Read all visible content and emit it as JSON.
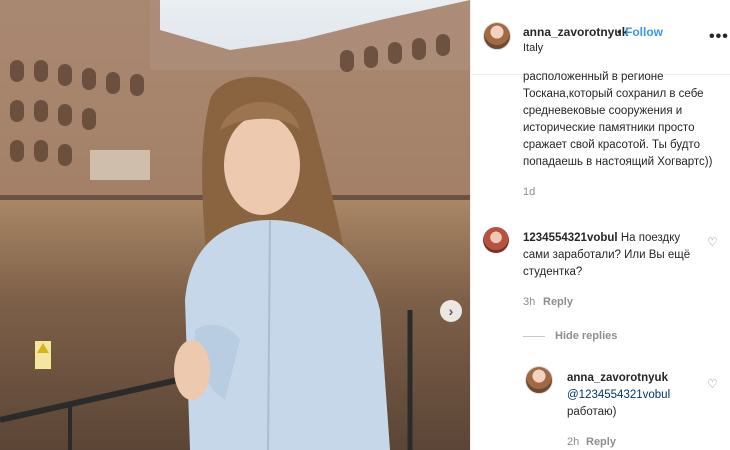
{
  "post": {
    "username": "anna_zavorotnyuk",
    "separator": "•",
    "follow_label": "Follow",
    "location": "Italy",
    "more_icon": "more-horizontal-icon"
  },
  "caption": {
    "text": "расположенный в регионе Тоскана,который сохранил в себе средневековые сооружения и исторические памятники просто сражает свой красотой. Ты будто попадаешь в настоящий Хогвартс))",
    "time": "1d"
  },
  "comments": [
    {
      "username": "1234554321vobul",
      "text": "На поездку сами заработали? Или Вы ещё студентка?",
      "time": "3h",
      "reply_label": "Reply"
    }
  ],
  "hide_replies_label": "Hide replies",
  "replies": [
    {
      "username": "anna_zavorotnyuk",
      "mention": "@1234554321vobul",
      "text": "работаю)",
      "time": "2h",
      "reply_label": "Reply"
    }
  ],
  "icons": {
    "next": "chevron-right-icon",
    "like": "heart-icon"
  },
  "colors": {
    "follow": "#3897f0",
    "muted": "#8e8e8e",
    "mention": "#00376b"
  }
}
